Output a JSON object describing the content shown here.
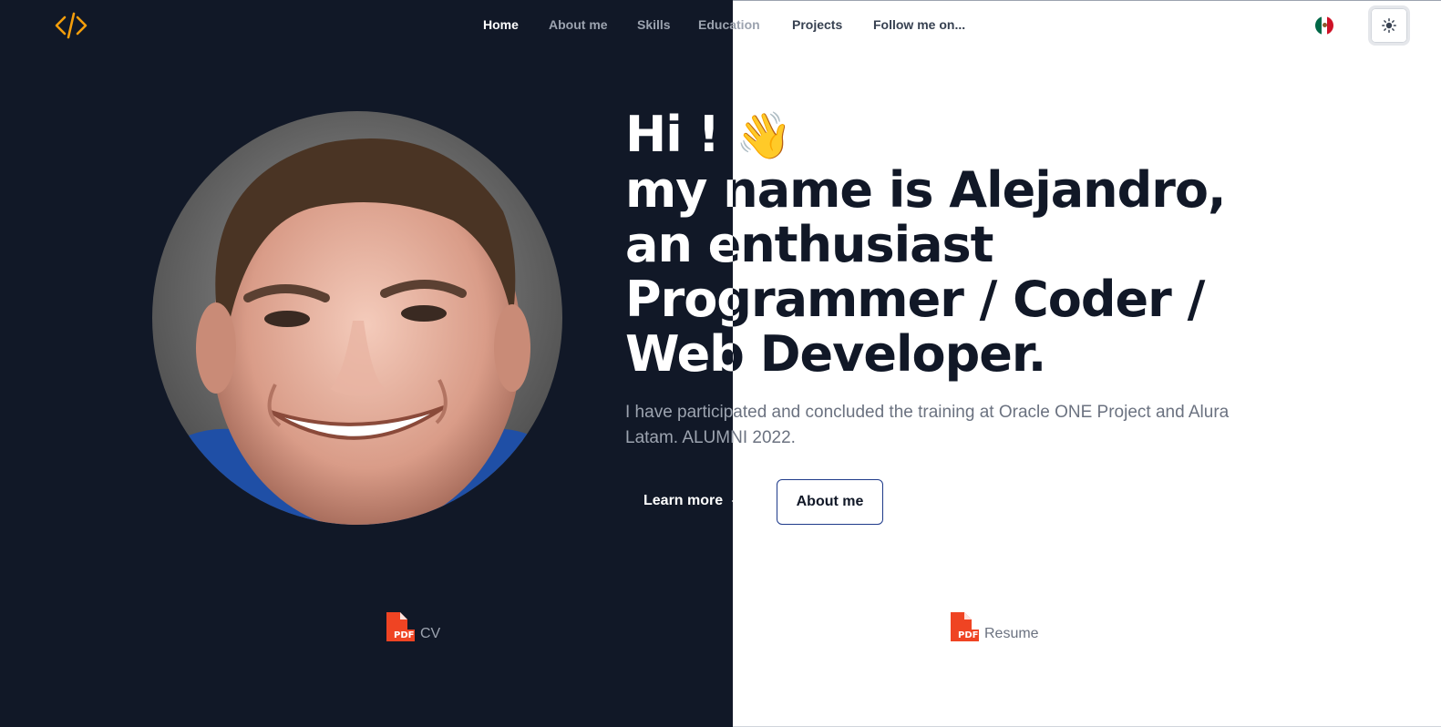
{
  "theme": {
    "dark_bg": "#111827",
    "accent": "#f59e0b",
    "light_bg": "#ffffff"
  },
  "logo": {
    "icon": "code-brackets-icon"
  },
  "nav": {
    "items": [
      {
        "label": "Home"
      },
      {
        "label": "About me"
      },
      {
        "label": "Skills"
      },
      {
        "label": "Education"
      },
      {
        "label": "Projects"
      },
      {
        "label": "Follow me on..."
      }
    ]
  },
  "header": {
    "flag_icon": "mexico-flag-icon",
    "theme_toggle_icon": "sun-icon"
  },
  "hero": {
    "greeting": "Hi !",
    "wave": "👋",
    "line2": "my name is Alejandro,",
    "line3": "an enthusiast",
    "line4": "Programmer / Coder /",
    "line5": "Web Developer.",
    "intro": "I have participated and concluded the training at Oracle ONE Project and Alura Latam. ALUMNI 2022.",
    "learn_more": "Learn more",
    "about_me": "About me"
  },
  "downloads": {
    "cv": "CV",
    "resume": "Resume",
    "icon": "pdf-file-icon",
    "icon_color": "#ef4423",
    "icon_text": "PDF"
  }
}
